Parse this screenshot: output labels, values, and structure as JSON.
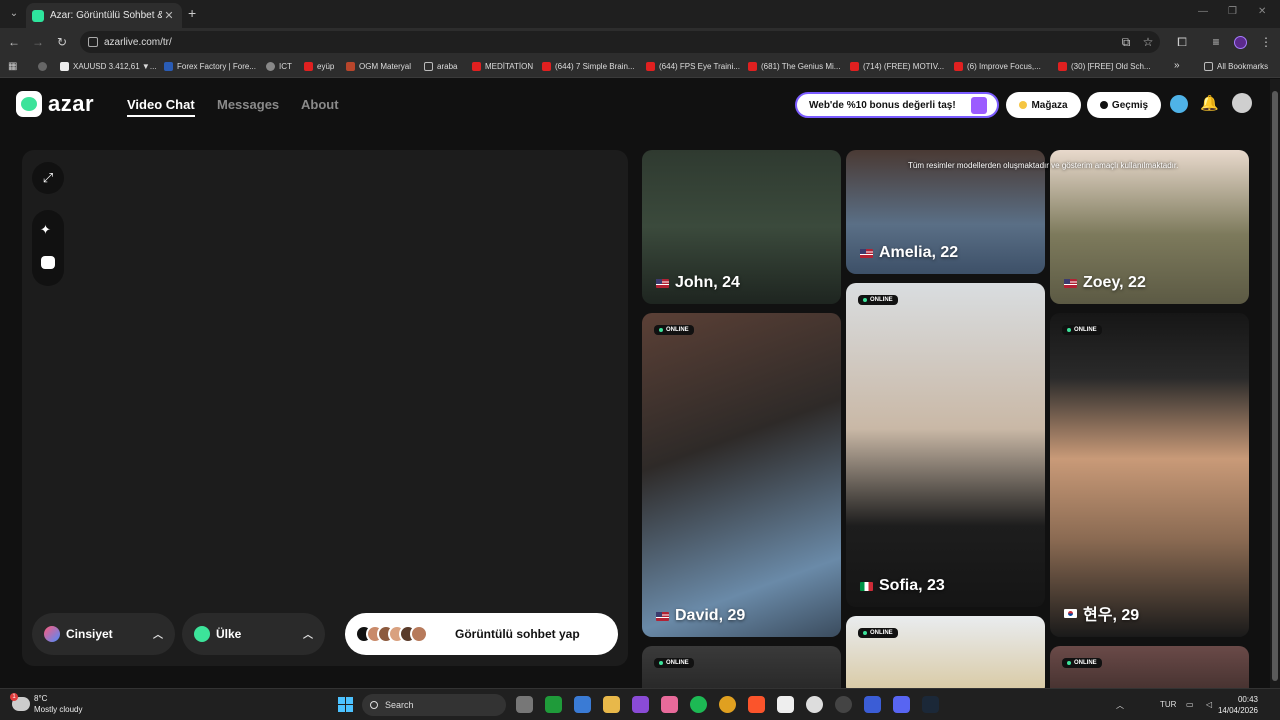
{
  "browser": {
    "tab_title": "Azar: Görüntülü Sohbet & Yeni İ",
    "url": "azarlive.com/tr/",
    "bookmarks": [
      {
        "label": "XAUUSD 3.412,61 ▼...",
        "icon": "tradingview-icon"
      },
      {
        "label": "Forex Factory | Fore...",
        "icon": "forex-factory-icon"
      },
      {
        "label": "ICT",
        "icon": "globe-icon"
      },
      {
        "label": "eyüp",
        "icon": "youtube-icon"
      },
      {
        "label": "OGM Materyal",
        "icon": "ogm-icon"
      },
      {
        "label": "araba",
        "icon": "folder-icon"
      },
      {
        "label": "MEDİTATİON",
        "icon": "youtube-icon"
      },
      {
        "label": "(644) 7 Simple Brain...",
        "icon": "youtube-icon"
      },
      {
        "label": "(644) FPS Eye Traini...",
        "icon": "youtube-icon"
      },
      {
        "label": "(681) The Genius Mi...",
        "icon": "youtube-icon"
      },
      {
        "label": "(714) (FREE) MOTIV...",
        "icon": "youtube-icon"
      },
      {
        "label": "(6) Improve Focus,...",
        "icon": "youtube-icon"
      },
      {
        "label": "(30) [FREE] Old Sch...",
        "icon": "youtube-icon"
      }
    ],
    "more_bookmarks": "»",
    "all_bookmarks": "All Bookmarks"
  },
  "header": {
    "logo_text": "azar",
    "nav": [
      "Video Chat",
      "Messages",
      "About"
    ],
    "promo": "Web'de %10 bonus değerli taş!",
    "store": "Mağaza",
    "history": "Geçmiş"
  },
  "stage": {
    "filters": {
      "gender": "Cinsiyet",
      "country": "Ülke"
    },
    "start_button": "Görüntülü sohbet yap"
  },
  "gallery": {
    "disclaimer": "Tüm resimler modellerden oluşmaktadır ve gösterim amaçlı kullanılmaktadır.",
    "online_label": "ONLINE",
    "profiles": [
      {
        "name": "John, 24",
        "flag": "us"
      },
      {
        "name": "Amelia, 22",
        "flag": "us"
      },
      {
        "name": "Zoey, 22",
        "flag": "us"
      },
      {
        "name": "David, 29",
        "flag": "us"
      },
      {
        "name": "Sofia, 23",
        "flag": "it"
      },
      {
        "name": "현우, 29",
        "flag": "kr"
      }
    ]
  },
  "taskbar": {
    "temperature": "8°C",
    "weather": "Mostly cloudy",
    "search": "Search",
    "language": "TUR",
    "time": "00:43",
    "date": "14/04/2026"
  },
  "colors": {
    "accent_green": "#3ce39a",
    "promo_border": "#7b5cff",
    "store_gem": "#f5c542"
  }
}
